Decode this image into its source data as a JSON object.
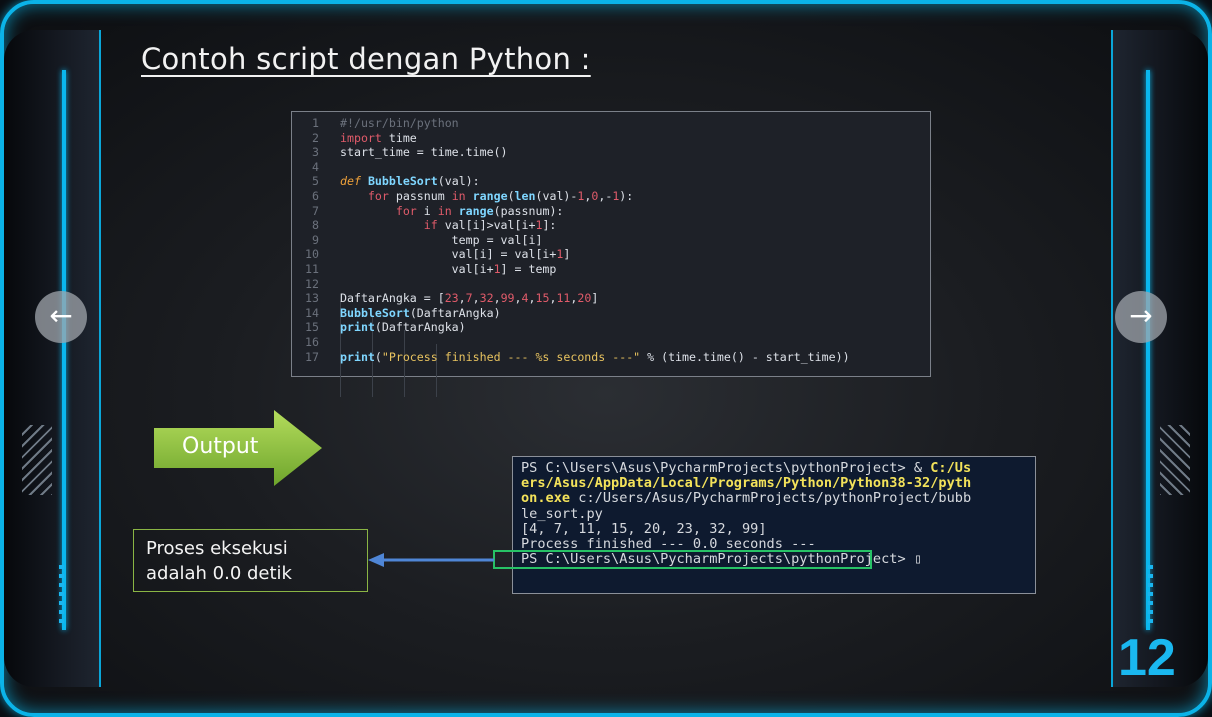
{
  "slide": {
    "title": "Contoh script dengan Python :",
    "page_number": "12",
    "accent_color": "#0bb3e8"
  },
  "code": {
    "lines": [
      {
        "n": "1",
        "t": "#!/usr/bin/python"
      },
      {
        "n": "2",
        "t": "import time"
      },
      {
        "n": "3",
        "t": "start_time = time.time()"
      },
      {
        "n": "4",
        "t": ""
      },
      {
        "n": "5",
        "t": "def BubbleSort(val):"
      },
      {
        "n": "6",
        "t": "    for passnum in range(len(val)-1,0,-1):"
      },
      {
        "n": "7",
        "t": "        for i in range(passnum):"
      },
      {
        "n": "8",
        "t": "            if val[i]>val[i+1]:"
      },
      {
        "n": "9",
        "t": "                temp = val[i]"
      },
      {
        "n": "10",
        "t": "                val[i] = val[i+1]"
      },
      {
        "n": "11",
        "t": "                val[i+1] = temp"
      },
      {
        "n": "12",
        "t": ""
      },
      {
        "n": "13",
        "t": "DaftarAngka = [23,7,32,99,4,15,11,20]"
      },
      {
        "n": "14",
        "t": "BubbleSort(DaftarAngka)"
      },
      {
        "n": "15",
        "t": "print(DaftarAngka)"
      },
      {
        "n": "16",
        "t": ""
      },
      {
        "n": "17",
        "t": "print(\"Process finished --- %s seconds ---\" % (time.time() - start_time))"
      }
    ]
  },
  "output_label": "Output",
  "terminal": {
    "line1_a": "PS C:\\Users\\Asus\\PycharmProjects\\pythonProject> & ",
    "line1_b": "C:/Us",
    "line2": "ers/Asus/AppData/Local/Programs/Python/Python38-32/pyth",
    "line3_a": "on.exe",
    "line3_b": " c:/Users/Asus/PycharmProjects/pythonProject/bubb",
    "line4": "le_sort.py",
    "line5": "[4, 7, 11, 15, 20, 23, 32, 99]",
    "line6": "Process finished --- 0.0 seconds ---",
    "line7": "PS C:\\Users\\Asus\\PycharmProjects\\pythonProject> ▯"
  },
  "note": {
    "line1": "Proses eksekusi",
    "line2": "adalah 0.0 detik"
  },
  "nav": {
    "prev_icon": "arrow-left-icon",
    "next_icon": "arrow-right-icon",
    "prev_glyph": "←",
    "next_glyph": "→"
  }
}
